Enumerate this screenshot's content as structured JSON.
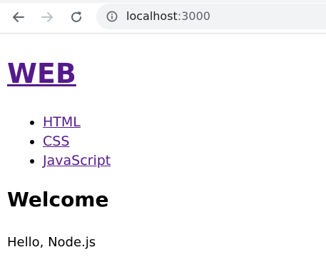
{
  "browser": {
    "url_host": "localhost",
    "url_port": ":3000",
    "icons": {
      "back": "back-arrow-icon",
      "forward": "forward-arrow-icon",
      "reload": "reload-icon",
      "site_info": "info-icon"
    }
  },
  "page": {
    "heading": "WEB",
    "nav_links": [
      "HTML",
      "CSS",
      "JavaScript"
    ],
    "section_title": "Welcome",
    "body_text": "Hello, Node.js"
  },
  "colors": {
    "visited_link": "#551a8b",
    "omnibox_bg": "#f1f3f4"
  }
}
